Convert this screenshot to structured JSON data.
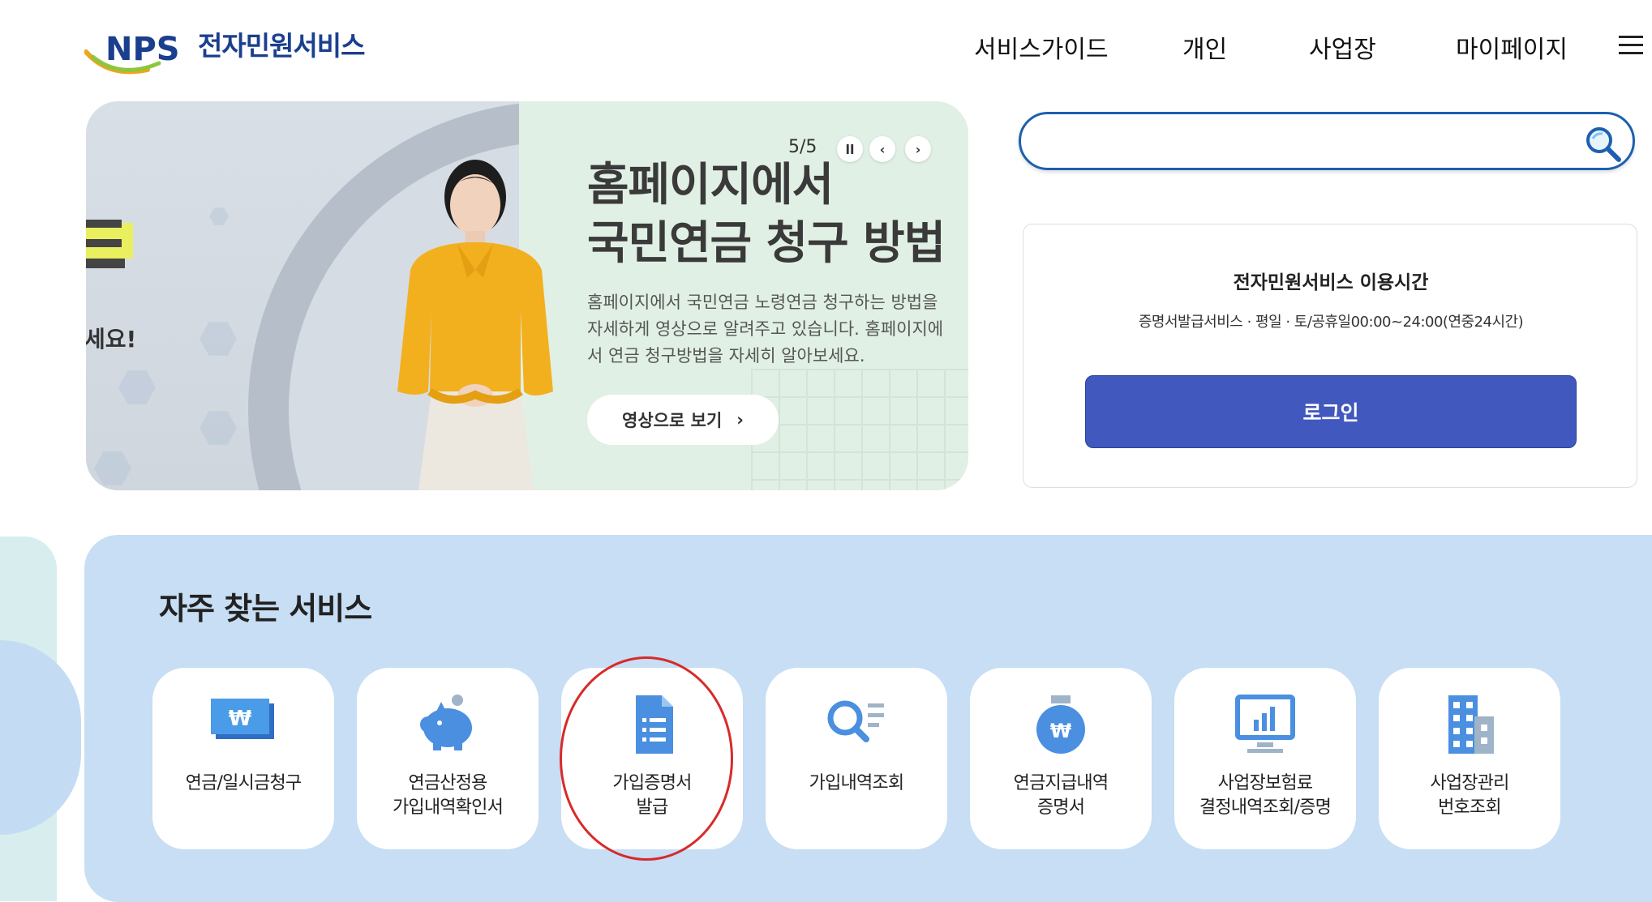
{
  "header": {
    "logo_text": "NPS",
    "service_name": "전자민원서비스",
    "nav": [
      "서비스가이드",
      "개인",
      "사업장",
      "마이페이지"
    ]
  },
  "banner": {
    "counter": "5/5",
    "title_line1": "홈페이지에서",
    "title_line2": "국민연금 청구 방법",
    "desc_line1": "홈페이지에서 국민연금 노령연금 청구하는 방법을",
    "desc_line2": "자세하게 영상으로 알려주고 있습니다. 홈페이지에",
    "desc_line3": "서 연금 청구방법을 자세히 알아보세요.",
    "video_button": "영상으로 보기",
    "prev_slide_text": "세요!",
    "controls": [
      "pause-icon",
      "chevron-left-icon",
      "chevron-right-icon"
    ]
  },
  "search": {
    "placeholder": "",
    "value": ""
  },
  "info_card": {
    "title": "전자민원서비스 이용시간",
    "subtitle": "증명서발급서비스 · 평일 · 토/공휴일00:00~24:00(연중24시간)",
    "login_button": "로그인"
  },
  "services": {
    "title": "자주 찾는 서비스",
    "items": [
      {
        "label": "연금/일시금청구",
        "icon": "won-bill-icon"
      },
      {
        "label": "연금산정용\n가입내역확인서",
        "icon": "piggy-bank-icon"
      },
      {
        "label": "가입증명서\n발급",
        "icon": "document-list-icon"
      },
      {
        "label": "가입내역조회",
        "icon": "search-list-icon"
      },
      {
        "label": "연금지급내역\n증명서",
        "icon": "money-bag-icon"
      },
      {
        "label": "사업장보험료\n결정내역조회/증명",
        "icon": "monitor-chart-icon"
      },
      {
        "label": "사업장관리\n번호조회",
        "icon": "building-icon"
      }
    ]
  },
  "colors": {
    "brand_blue": "#1b3f8f",
    "login_button": "#4158bf",
    "services_bg": "#c7def4",
    "icon_blue": "#4a8fe0",
    "highlight_red": "#d82a2a"
  }
}
